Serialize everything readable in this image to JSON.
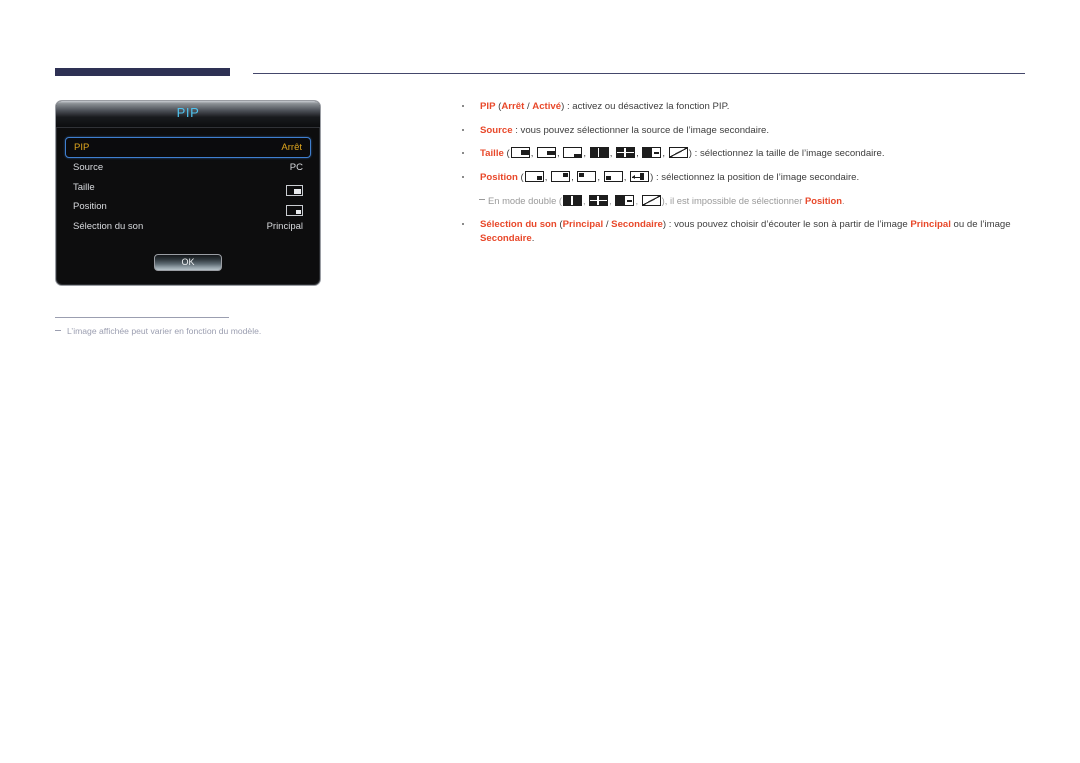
{
  "header": {
    "accent_color": "#2e3154",
    "rule_color": "#44476b"
  },
  "osd_dialog": {
    "title": "PIP",
    "rows": [
      {
        "label": "PIP",
        "value": "Arrêt",
        "value_type": "text",
        "selected": true
      },
      {
        "label": "Source",
        "value": "PC",
        "value_type": "text",
        "selected": false
      },
      {
        "label": "Taille",
        "value": "",
        "value_type": "icon-size",
        "selected": false
      },
      {
        "label": "Position",
        "value": "",
        "value_type": "icon-position",
        "selected": false
      },
      {
        "label": "Sélection du son",
        "value": "Principal",
        "value_type": "text",
        "selected": false
      }
    ],
    "ok_label": "OK",
    "title_color": "#4fc3ef",
    "selected_color": "#e0a71e",
    "selection_border_color": "#3f7fd0"
  },
  "content": {
    "accent_color": "#e8482a",
    "bullets": [
      {
        "id": "pip",
        "segments": [
          {
            "t": "PIP",
            "kw": true
          },
          {
            "t": " (",
            "kw": false
          },
          {
            "t": "Arrêt",
            "kw": true
          },
          {
            "t": " / ",
            "kw": false
          },
          {
            "t": "Activé",
            "kw": true
          },
          {
            "t": ") : activez ou désactivez la fonction PIP.",
            "kw": false
          }
        ]
      },
      {
        "id": "source",
        "segments": [
          {
            "t": "Source",
            "kw": true
          },
          {
            "t": " : vous pouvez sélectionner la source de l’image secondaire.",
            "kw": false
          }
        ]
      },
      {
        "id": "taille",
        "lead": "Taille",
        "open_paren": " (",
        "icons": [
          "size-right-middle",
          "size-right-middle-small",
          "size-right-bottom",
          "split-vertical",
          "split-quad",
          "block-left-dash-right",
          "split-diagonal"
        ],
        "close_paren": ") : ",
        "tail": "sélectionnez la taille de l’image secondaire."
      },
      {
        "id": "position",
        "lead": "Position",
        "open_paren": " (",
        "icons": [
          "pos-bottom-right",
          "pos-top-right",
          "pos-top-left",
          "pos-bottom-left",
          "pos-arrow-left"
        ],
        "close_paren": ") : ",
        "tail": "sélectionnez la position de l’image secondaire."
      }
    ],
    "subnote": {
      "lead": "En mode double (",
      "icons": [
        "split-vertical",
        "split-quad",
        "block-left-dash-right",
        "split-diagonal"
      ],
      "mid": "), il est impossible de sélectionner ",
      "kw": "Position",
      "end": "."
    },
    "last_bullet": {
      "segments": [
        {
          "t": "Sélection du son",
          "kw": true
        },
        {
          "t": " (",
          "kw": false
        },
        {
          "t": "Principal",
          "kw": true
        },
        {
          "t": " / ",
          "kw": false
        },
        {
          "t": "Secondaire",
          "kw": true
        },
        {
          "t": ") : vous pouvez choisir d’écouter le son à partir de l’image ",
          "kw": false
        },
        {
          "t": "Principal",
          "kw": true
        },
        {
          "t": " ou de l’image ",
          "kw": false
        },
        {
          "t": "Secondaire",
          "kw": true
        },
        {
          "t": ".",
          "kw": false
        }
      ]
    }
  },
  "footnote": {
    "text": "L’image affichée peut varier en fonction du modèle.",
    "color": "#9b9eb0"
  }
}
